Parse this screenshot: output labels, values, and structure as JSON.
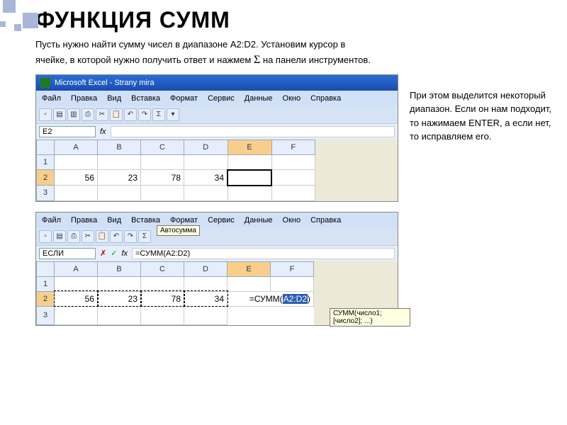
{
  "slide": {
    "title": "ФУНКЦИЯ СУММ",
    "intro_a": "Пусть нужно найти сумму чисел в диапазоне A2:D2. Установим курсор в",
    "intro_b": "ячейке, в которой нужно получить ответ и нажмем ",
    "sigma": "Σ",
    "intro_c": " на панели инструментов."
  },
  "side": "При этом выделится некоторый диапазон. Если он нам подходит, то нажимаем ENTER, а если нет, то исправляем его.",
  "excel": {
    "title": "Microsoft Excel - Strany mira",
    "menus": [
      "Файл",
      "Правка",
      "Вид",
      "Вставка",
      "Формат",
      "Сервис",
      "Данные",
      "Окно",
      "Справка"
    ],
    "cols": [
      "A",
      "B",
      "C",
      "D",
      "E",
      "F"
    ],
    "rows": [
      "1",
      "2",
      "3"
    ],
    "values": {
      "A2": "56",
      "B2": "23",
      "C2": "78",
      "D2": "34"
    },
    "namebox1": "E2",
    "namebox2": "ЕСЛИ",
    "formula": "=СУММ(A2:D2)",
    "inline_formula_pre": "=СУММ(",
    "inline_formula_sel": "A2:D2",
    "inline_formula_post": ")",
    "tooltip": "СУММ(число1; [число2]; ...)",
    "autosum_tip": "Автосумма",
    "autosum": "Σ"
  }
}
